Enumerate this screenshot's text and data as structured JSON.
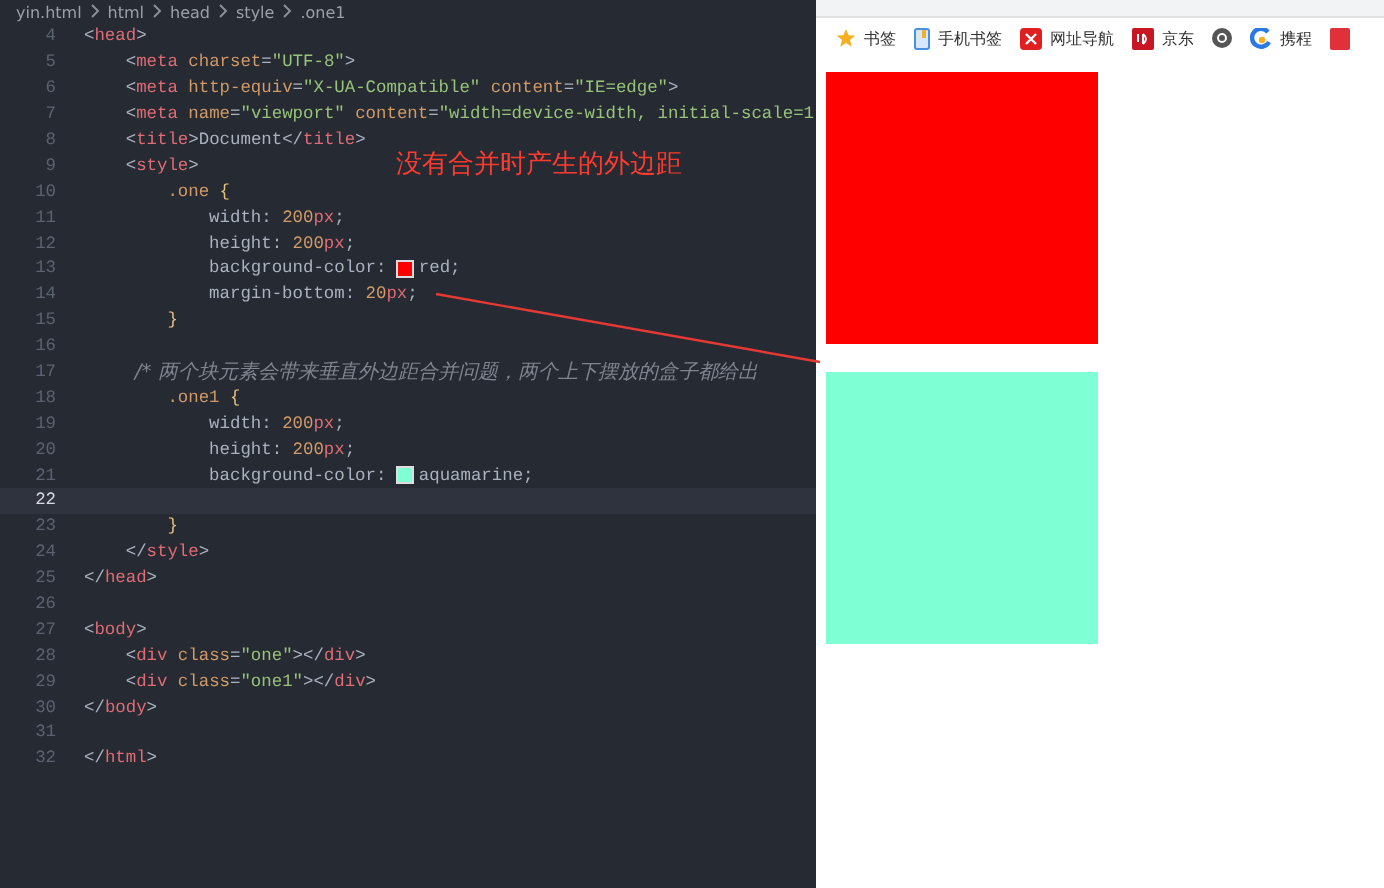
{
  "breadcrumb": [
    "yin.html",
    "html",
    "head",
    "style",
    ".one1"
  ],
  "editor_lines": [
    {
      "number": "4",
      "current": false,
      "tokens": [
        {
          "kind": "p",
          "text": "<"
        },
        {
          "kind": "tag",
          "text": "head"
        },
        {
          "kind": "p",
          "text": ">"
        }
      ]
    },
    {
      "number": "5",
      "current": false,
      "tokens": [
        {
          "kind": "p",
          "text": "    <"
        },
        {
          "kind": "tag",
          "text": "meta"
        },
        {
          "kind": "attr",
          "text": " charset"
        },
        {
          "kind": "p",
          "text": "="
        },
        {
          "kind": "str",
          "text": "\"UTF-8\""
        },
        {
          "kind": "p",
          "text": ">"
        }
      ]
    },
    {
      "number": "6",
      "current": false,
      "tokens": [
        {
          "kind": "p",
          "text": "    <"
        },
        {
          "kind": "tag",
          "text": "meta"
        },
        {
          "kind": "attr",
          "text": " http-equiv"
        },
        {
          "kind": "p",
          "text": "="
        },
        {
          "kind": "str",
          "text": "\"X-UA-Compatible\""
        },
        {
          "kind": "attr",
          "text": " content"
        },
        {
          "kind": "p",
          "text": "="
        },
        {
          "kind": "str",
          "text": "\"IE=edge\""
        },
        {
          "kind": "p",
          "text": ">"
        }
      ]
    },
    {
      "number": "7",
      "current": false,
      "tokens": [
        {
          "kind": "p",
          "text": "    <"
        },
        {
          "kind": "tag",
          "text": "meta"
        },
        {
          "kind": "attr",
          "text": " name"
        },
        {
          "kind": "p",
          "text": "="
        },
        {
          "kind": "str",
          "text": "\"viewport\""
        },
        {
          "kind": "attr",
          "text": " content"
        },
        {
          "kind": "p",
          "text": "="
        },
        {
          "kind": "str",
          "text": "\"width=device-width, initial-scale=1"
        }
      ]
    },
    {
      "number": "8",
      "current": false,
      "tokens": [
        {
          "kind": "p",
          "text": "    <"
        },
        {
          "kind": "tag",
          "text": "title"
        },
        {
          "kind": "p",
          "text": ">"
        },
        {
          "kind": "text",
          "text": "Document"
        },
        {
          "kind": "p",
          "text": "</"
        },
        {
          "kind": "tag",
          "text": "title"
        },
        {
          "kind": "p",
          "text": ">"
        }
      ]
    },
    {
      "number": "9",
      "current": false,
      "tokens": [
        {
          "kind": "p",
          "text": "    <"
        },
        {
          "kind": "tag",
          "text": "style"
        },
        {
          "kind": "p",
          "text": ">"
        }
      ]
    },
    {
      "number": "10",
      "current": false,
      "tokens": [
        {
          "kind": "sel",
          "text": "        .one "
        },
        {
          "kind": "brace",
          "text": "{"
        }
      ]
    },
    {
      "number": "11",
      "current": false,
      "tokens": [
        {
          "kind": "text",
          "text": "            width: "
        },
        {
          "kind": "num",
          "text": "200"
        },
        {
          "kind": "unit",
          "text": "px"
        },
        {
          "kind": "p",
          "text": ";"
        }
      ]
    },
    {
      "number": "12",
      "current": false,
      "tokens": [
        {
          "kind": "text",
          "text": "            height: "
        },
        {
          "kind": "num",
          "text": "200"
        },
        {
          "kind": "unit",
          "text": "px"
        },
        {
          "kind": "p",
          "text": ";"
        }
      ]
    },
    {
      "number": "13",
      "current": false,
      "tokens": [
        {
          "kind": "text",
          "text": "            background-color: "
        },
        {
          "kind": "swatch",
          "color": "#ff0000"
        },
        {
          "kind": "text",
          "text": "red;"
        }
      ]
    },
    {
      "number": "14",
      "current": false,
      "tokens": [
        {
          "kind": "text",
          "text": "            margin-bottom: "
        },
        {
          "kind": "num",
          "text": "20"
        },
        {
          "kind": "unit",
          "text": "px"
        },
        {
          "kind": "p",
          "text": ";"
        }
      ]
    },
    {
      "number": "15",
      "current": false,
      "tokens": [
        {
          "kind": "brace",
          "text": "        }"
        }
      ]
    },
    {
      "number": "16",
      "current": false
    },
    {
      "number": "17",
      "current": false,
      "tokens": [
        {
          "kind": "comment",
          "text": "        /* 两个块元素会带来垂直外边距合并问题，两个上下摆放的盒子都给出"
        }
      ]
    },
    {
      "number": "18",
      "current": false,
      "tokens": [
        {
          "kind": "sel",
          "text": "        .one1 "
        },
        {
          "kind": "brace",
          "text": "{"
        }
      ]
    },
    {
      "number": "19",
      "current": false,
      "tokens": [
        {
          "kind": "text",
          "text": "            width: "
        },
        {
          "kind": "num",
          "text": "200"
        },
        {
          "kind": "unit",
          "text": "px"
        },
        {
          "kind": "p",
          "text": ";"
        }
      ]
    },
    {
      "number": "20",
      "current": false,
      "tokens": [
        {
          "kind": "text",
          "text": "            height: "
        },
        {
          "kind": "num",
          "text": "200"
        },
        {
          "kind": "unit",
          "text": "px"
        },
        {
          "kind": "p",
          "text": ";"
        }
      ]
    },
    {
      "number": "21",
      "current": false,
      "tokens": [
        {
          "kind": "text",
          "text": "            background-color: "
        },
        {
          "kind": "swatch",
          "color": "#7fffd4"
        },
        {
          "kind": "text",
          "text": "aquamarine;"
        }
      ]
    },
    {
      "number": "22",
      "current": true
    },
    {
      "number": "23",
      "current": false,
      "tokens": [
        {
          "kind": "brace",
          "text": "        }"
        }
      ]
    },
    {
      "number": "24",
      "current": false,
      "tokens": [
        {
          "kind": "p",
          "text": "    </"
        },
        {
          "kind": "tag",
          "text": "style"
        },
        {
          "kind": "p",
          "text": ">"
        }
      ]
    },
    {
      "number": "25",
      "current": false,
      "tokens": [
        {
          "kind": "p",
          "text": "</"
        },
        {
          "kind": "tag",
          "text": "head"
        },
        {
          "kind": "p",
          "text": ">"
        }
      ]
    },
    {
      "number": "26",
      "current": false
    },
    {
      "number": "27",
      "current": false,
      "tokens": [
        {
          "kind": "p",
          "text": "<"
        },
        {
          "kind": "tag",
          "text": "body"
        },
        {
          "kind": "p",
          "text": ">"
        }
      ]
    },
    {
      "number": "28",
      "current": false,
      "tokens": [
        {
          "kind": "p",
          "text": "    <"
        },
        {
          "kind": "tag",
          "text": "div"
        },
        {
          "kind": "attr",
          "text": " class"
        },
        {
          "kind": "p",
          "text": "="
        },
        {
          "kind": "str",
          "text": "\"one\""
        },
        {
          "kind": "p",
          "text": "></"
        },
        {
          "kind": "tag",
          "text": "div"
        },
        {
          "kind": "p",
          "text": ">"
        }
      ]
    },
    {
      "number": "29",
      "current": false,
      "tokens": [
        {
          "kind": "p",
          "text": "    <"
        },
        {
          "kind": "tag",
          "text": "div"
        },
        {
          "kind": "attr",
          "text": " class"
        },
        {
          "kind": "p",
          "text": "="
        },
        {
          "kind": "str",
          "text": "\"one1\""
        },
        {
          "kind": "p",
          "text": "></"
        },
        {
          "kind": "tag",
          "text": "div"
        },
        {
          "kind": "p",
          "text": ">"
        }
      ]
    },
    {
      "number": "30",
      "current": false,
      "tokens": [
        {
          "kind": "p",
          "text": "</"
        },
        {
          "kind": "tag",
          "text": "body"
        },
        {
          "kind": "p",
          "text": ">"
        }
      ]
    },
    {
      "number": "31",
      "current": false
    },
    {
      "number": "32",
      "current": false,
      "tokens": [
        {
          "kind": "p",
          "text": "</"
        },
        {
          "kind": "tag",
          "text": "html"
        },
        {
          "kind": "p",
          "text": ">"
        }
      ]
    }
  ],
  "annotation": "没有合并时产生的外边距",
  "bookmarks": [
    {
      "kind": "star",
      "label": "书签"
    },
    {
      "kind": "phone",
      "label": "手机书签"
    },
    {
      "kind": "nav",
      "label": "网址导航"
    },
    {
      "kind": "jd",
      "label": "京东"
    },
    {
      "kind": "circle"
    },
    {
      "kind": "swirl",
      "label": "携程"
    },
    {
      "kind": "red"
    }
  ],
  "boxes": [
    {
      "color": "#ff0000"
    },
    {
      "color": "#7fffd4"
    }
  ]
}
